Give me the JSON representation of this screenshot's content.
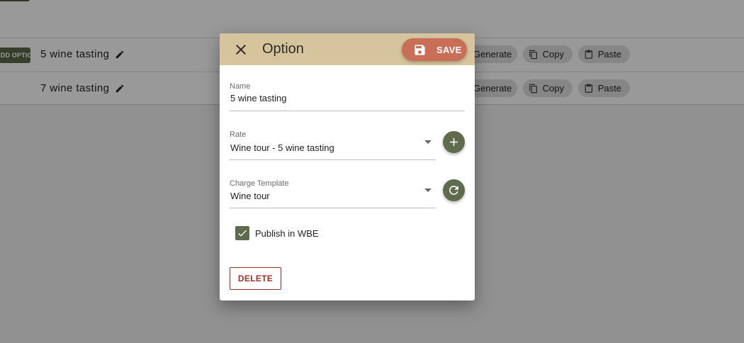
{
  "background": {
    "rows": [
      {
        "tag": "ADD OPTION",
        "title": "5 wine tasting",
        "actions": {
          "generate": "Generate",
          "copy": "Copy",
          "paste": "Paste"
        }
      },
      {
        "title": "7 wine tasting",
        "actions": {
          "generate": "Generate",
          "copy": "Copy",
          "paste": "Paste"
        }
      }
    ]
  },
  "dialog": {
    "title": "Option",
    "save_label": "SAVE",
    "fields": {
      "name": {
        "label": "Name",
        "value": "5 wine tasting"
      },
      "rate": {
        "label": "Rate",
        "value": "Wine tour - 5 wine tasting"
      },
      "charge_template": {
        "label": "Charge Template",
        "value": "Wine tour"
      }
    },
    "publish": {
      "label": "Publish in WBE",
      "checked": true
    },
    "delete_label": "DELETE"
  },
  "colors": {
    "header": "#d5c49c",
    "save": "#c96e57",
    "accent": "#5e6b4c",
    "danger": "#9b2f26"
  },
  "icons": [
    "close-icon",
    "save-icon",
    "add-icon",
    "refresh-icon",
    "check-icon",
    "pencil-icon",
    "copy-icon",
    "paste-icon"
  ]
}
